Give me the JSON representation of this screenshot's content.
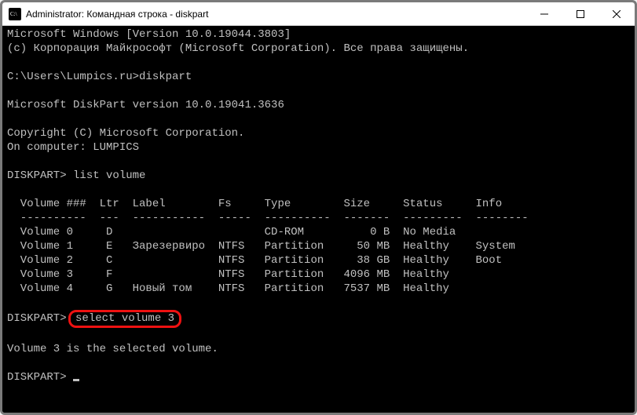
{
  "titlebar": {
    "icon_glyph": "c:\\",
    "title": "Administrator: Командная строка - diskpart"
  },
  "terminal": {
    "lines_before": "Microsoft Windows [Version 10.0.19044.3803]\n(c) Корпорация Майкрософт (Microsoft Corporation). Все права защищены.\n\nC:\\Users\\Lumpics.ru>diskpart\n\nMicrosoft DiskPart version 10.0.19041.3636\n\nCopyright (C) Microsoft Corporation.\nOn computer: LUMPICS\n\nDISKPART> list volume\n",
    "table_header": "  Volume ###  Ltr  Label        Fs     Type        Size     Status     Info",
    "table_divider": "  ----------  ---  -----------  -----  ----------  -------  ---------  --------",
    "table_rows": [
      "  Volume 0     D                       CD-ROM          0 B  No Media",
      "  Volume 1     E   Зарезервиро  NTFS   Partition     50 MB  Healthy    System",
      "  Volume 2     C                NTFS   Partition     38 GB  Healthy    Boot",
      "  Volume 3     F                NTFS   Partition   4096 MB  Healthy",
      "  Volume 4     G   Новый том    NTFS   Partition   7537 MB  Healthy"
    ],
    "prompt2_prefix": "DISKPART> ",
    "highlighted_command": "select volume 3",
    "response": "Volume 3 is the selected volume.",
    "prompt3": "DISKPART> "
  }
}
